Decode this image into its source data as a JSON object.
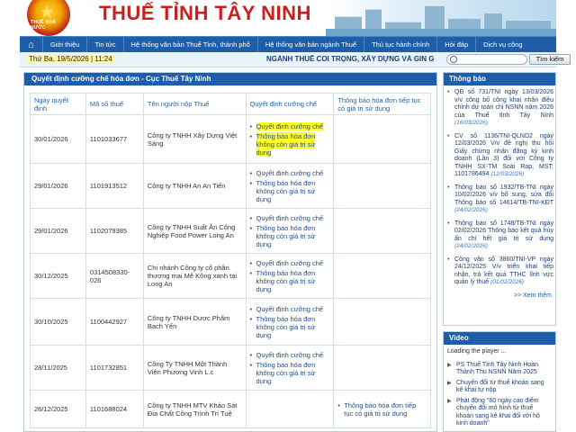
{
  "header": {
    "site_title": "THUẾ TỈNH TÂY NINH",
    "emblem_text": "THUẾ NHÀ NƯỚC"
  },
  "nav": {
    "home_icon": "home-icon",
    "items": [
      "Giới thiệu",
      "Tin tức",
      "Hệ thống văn bản Thuế Tỉnh, thành phố",
      "Hệ thống văn bản ngành Thuế",
      "Thủ tục hành chính",
      "Hỏi đáp",
      "Dịch vụ công"
    ]
  },
  "datebar": {
    "date": "Thứ Ba, 19/5/2026 | 11:24",
    "ticker": "NGÀNH THUẾ COI TRỌNG, XÂY DỰNG VÀ GIN G",
    "search_placeholder": "",
    "search_button": "Tìm kiếm"
  },
  "main": {
    "panel_title": "Quyết định cưỡng chế hóa đơn - Cục Thuế Tây Ninh",
    "columns": [
      "Ngày quyết định",
      "Mã số thuế",
      "Tên người nộp Thuế",
      "Quyết định cưỡng chế",
      "Thông báo hóa đơn tiếp tục có giá trị sử dụng"
    ],
    "rows": [
      {
        "date": "30/01/2026",
        "tax": "1101033677",
        "name": "Công ty TNHH Xây Dựng Việt Sáng",
        "decisions": [
          "Quyết định cưỡng chế",
          "Thông báo hóa đơn không còn giá trị sử dụng"
        ],
        "notice": [],
        "highlight": true
      },
      {
        "date": "29/01/2026",
        "tax": "1101913512",
        "name": "Công ty TNHH An An Tiến",
        "decisions": [
          "Quyết định cưỡng chế",
          "Thông báo hóa đơn không còn giá trị sử dụng"
        ],
        "notice": []
      },
      {
        "date": "29/01/2026",
        "tax": "1102079385",
        "name": "Công ty TNHH Suất Ăn Công Nghiệp Food Power Long An",
        "decisions": [
          "Quyết định cưỡng chế",
          "Thông báo hóa đơn không còn giá trị sử dụng"
        ],
        "notice": []
      },
      {
        "date": "30/12/2025",
        "tax": "0314508330-026",
        "name": "Chi nhánh Công ty cổ phần thương mại Mê Kông xanh tại Long An",
        "decisions": [
          "Quyết định cưỡng chế",
          "Thông báo hóa đơn không còn giá trị sử dụng"
        ],
        "notice": []
      },
      {
        "date": "30/10/2025",
        "tax": "1100442927",
        "name": "Công ty TNHH Dược Phẩm Bạch Yến",
        "decisions": [
          "Quyết định cưỡng chế",
          "Thông báo hóa đơn không còn giá trị sử dụng"
        ],
        "notice": []
      },
      {
        "date": "28/11/2025",
        "tax": "1101732851",
        "name": "Công Ty TNHH Một Thành Viên Phương Vinh L.c",
        "decisions": [
          "Quyết định cưỡng chế",
          "Thông báo hóa đơn không còn giá trị sử dụng"
        ],
        "notice": []
      },
      {
        "date": "26/12/2025",
        "tax": "1101688024",
        "name": "Công ty TNHH MTV Khảo Sát Địa Chất Công Trình Trí Tuệ",
        "decisions": [],
        "notice": [
          "Thông báo hóa đơn tiếp tục có giá trị sử dụng"
        ]
      }
    ]
  },
  "sidebar": {
    "notices_title": "Thông báo",
    "notices": [
      {
        "text": "QĐ số 731/TNI ngày 13/03/2026 v/v công bố công khai nhân điều chỉnh dự toán chi NSNN năm 2026 của Thuế tỉnh Tây Ninh",
        "date": "(16/03/2026)"
      },
      {
        "text": "CV số 1136/TNI-QLND2 ngày 12/03/2026 V/v đề nghị thu hồi Giấy chứng nhận đăng ký kinh doanh (Lần 3) đối với Công ty TNHH SX-TM Soái Rạp, MST: 1101786494",
        "date": "(12/03/2026)"
      },
      {
        "text": "Thông báo số 1932/TB-TNI ngày 10/02/2026 v/v bổ sung, sửa đổi Thông báo số 14614/TB-TNI-KĐT",
        "date": "(24/02/2026)"
      },
      {
        "text": "Thông báo số 1748/TB-TNI ngày 02/02/2026 Thông báo kết quả hủy ấn chỉ hết giá trị sử dụng",
        "date": "(24/02/2026)"
      },
      {
        "text": "Công văn số 3860/TNI-VP ngày 24/12/2025 V/v triển khai tiếp nhận, trả kết quả TTHC lĩnh vực quản lý thuế",
        "date": "(01/02/2026)"
      }
    ],
    "view_more": ">> Xem thêm",
    "video_title": "Video",
    "video_loading": "Loading the player ...",
    "videos": [
      "PS Thuế Tỉnh Tây Ninh Hoàn Thành Thu NSNN Năm 2025",
      "Chuyển đổi từ thuế khoán sang kê khai tự nộp",
      "Phát động \"60 ngày cao điểm chuyển đổi mô hình từ thuế khoán sang kê khai đối với hộ kinh doanh\""
    ]
  }
}
